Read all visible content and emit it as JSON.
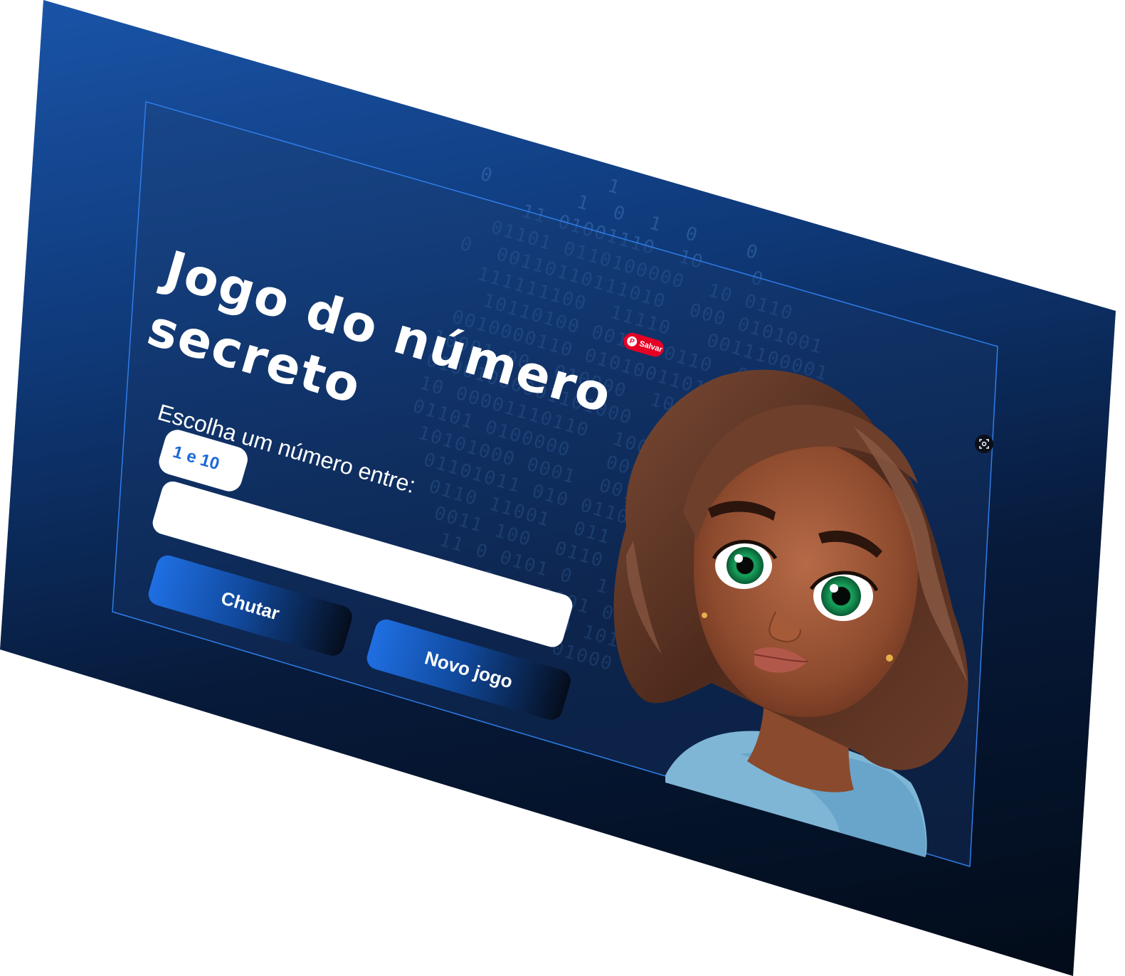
{
  "header": {
    "title_line1": "Jogo do número",
    "title_line2": "secreto"
  },
  "prompt": {
    "text": "Escolha um número entre:",
    "range_label": "1 e 10"
  },
  "input": {
    "value": "",
    "placeholder": ""
  },
  "buttons": {
    "guess_label": "Chutar",
    "new_game_label": "Novo jogo"
  },
  "overlay": {
    "pin_label": "Salvar"
  },
  "background": {
    "binary_rows": [
      "          1",
      "0       1  0  1  0    0",
      "    11 01001110  10    0",
      "  01101 0110100000  10 0110",
      "0  00110110111010  000 0101001",
      "  111111100  11110   0011100001",
      "   10110100 0010000110  0001000",
      " 0010000110 01010011011  1 0",
      "10001 00  010000  101101000  0",
      "01001000001101000  00 0011 0 10",
      "10 00001110110  100000 1 1",
      "01101 0100000   00 0  01 011",
      " 10101000 0001  0011  00 10 0",
      "  01101011 010 0110  0 1 0100011 00",
      "   0110 11001  011  0 0101   0",
      "    0011 100  0110   101 1  0",
      "     11 0 0101 0  1 0000 1  0 11",
      "      1  0    1101 00011  00 100",
      "    0       0   0 1011   0",
      "                01000  0 1"
    ]
  }
}
